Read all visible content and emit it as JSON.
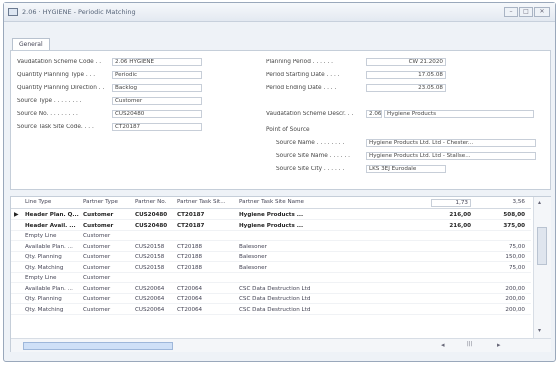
{
  "window": {
    "title": "2.06 · HYGIENE - Periodic Matching",
    "min": "–",
    "max": "□",
    "close": "✕"
  },
  "tabs": [
    "General"
  ],
  "left_fields": [
    {
      "label": "Vaudatation Scheme Code . .",
      "value": "2.06    HYGIENE"
    },
    {
      "label": "Quantity Planning Type . . .",
      "value": "Periodic"
    },
    {
      "label": "Quantity Planning Direction . .",
      "value": "Backlog"
    },
    {
      "label": "Source Type . . . . . . . .",
      "value": "Customer"
    },
    {
      "label": "Source No. . . . . . . . .",
      "value": "CUS20480"
    },
    {
      "label": "Source Task Site Code. . . .",
      "value": "CT20187"
    }
  ],
  "right_fields": [
    {
      "label": "Planning Period . . . . . .",
      "value": "CW 21.2020"
    },
    {
      "label": "Period Starting Date . . . .",
      "value": "17.05.08"
    },
    {
      "label": "Period Ending Date . . . .",
      "value": "23.05.08"
    }
  ],
  "scheme_desc": {
    "label": "Vaudatation Scheme Descr. . .",
    "code": "2.06",
    "value": "Hygiene Products"
  },
  "point_of_source": {
    "heading": "Point of Source",
    "fields": [
      {
        "label": "Source Name . . . . . . . .",
        "value": "Hygiene Products Ltd. Ltd - Chester..."
      },
      {
        "label": "Source Site Name . . . . . .",
        "value": "Hygiene Products Ltd. Ltd - Stallse..."
      },
      {
        "label": "Source Site City . . . . . .",
        "value": "LKS 3EJ Eurodale"
      }
    ]
  },
  "grid": {
    "columns": [
      "Line Type",
      "Partner Type",
      "Partner No.",
      "Partner Task Sit...",
      "Partner Task Site Name",
      "1,73",
      "3,56"
    ],
    "selector": "▶",
    "rows": [
      {
        "bold": true,
        "selected": true,
        "cells": [
          "Header Plan. Q...",
          "Customer",
          "CUS20480",
          "CT20187",
          "Hygiene Products ...",
          "216,00",
          "508,00"
        ]
      },
      {
        "bold": true,
        "selected": false,
        "cells": [
          "Header Avail. ...",
          "Customer",
          "CUS20480",
          "CT20187",
          "Hygiene Products ...",
          "216,00",
          "375,00"
        ]
      },
      {
        "bold": false,
        "selected": false,
        "cells": [
          "Empty Line",
          "Customer",
          "",
          "",
          "",
          "",
          ""
        ]
      },
      {
        "bold": false,
        "selected": false,
        "cells": [
          "Available Plan. ...",
          "Customer",
          "CUS20158",
          "CT20188",
          "Balesoner",
          "",
          "75,00"
        ]
      },
      {
        "bold": false,
        "selected": false,
        "cells": [
          "Qty. Planning",
          "Customer",
          "CUS20158",
          "CT20188",
          "Balesoner",
          "",
          "150,00"
        ]
      },
      {
        "bold": false,
        "selected": false,
        "cells": [
          "Qty. Matching",
          "Customer",
          "CUS20158",
          "CT20188",
          "Balesoner",
          "",
          "75,00"
        ]
      },
      {
        "bold": false,
        "selected": false,
        "cells": [
          "Empty Line",
          "Customer",
          "",
          "",
          "",
          "",
          ""
        ]
      },
      {
        "bold": false,
        "selected": false,
        "cells": [
          "Available Plan. ...",
          "Customer",
          "CUS20064",
          "CT20064",
          "CSC Data Destruction Ltd",
          "",
          "200,00"
        ]
      },
      {
        "bold": false,
        "selected": false,
        "cells": [
          "Qty. Planning",
          "Customer",
          "CUS20064",
          "CT20064",
          "CSC Data Destruction Ltd",
          "",
          "200,00"
        ]
      },
      {
        "bold": false,
        "selected": false,
        "cells": [
          "Qty. Matching",
          "Customer",
          "CUS20064",
          "CT20064",
          "CSC Data Destruction Ltd",
          "",
          "200,00"
        ]
      }
    ]
  },
  "scroll": {
    "up": "▴",
    "down": "▾",
    "left": "◂",
    "right": "▸",
    "center": "|||"
  }
}
